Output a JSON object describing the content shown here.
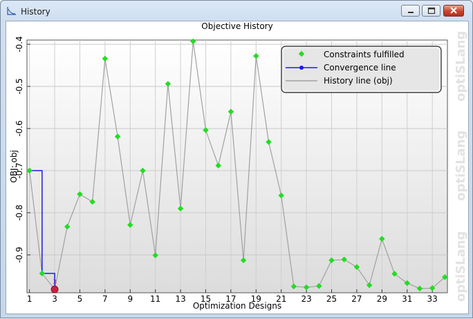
{
  "window": {
    "title": "History"
  },
  "plot": {
    "title": "Objective History",
    "watermark": "optiSLang"
  },
  "legend": [
    {
      "label": "Constraints fulfilled",
      "kind": "marker",
      "color": "#22dd22"
    },
    {
      "label": "Convergence line",
      "kind": "line-marker",
      "color": "#1a1aee"
    },
    {
      "label": "History line (obj)",
      "kind": "line",
      "color": "#a0a0a0"
    }
  ],
  "colors": {
    "history": "#a0a0a0",
    "convergence": "#1a1aee",
    "fulfilled": "#22dd22",
    "best": "#cc2244"
  },
  "chart_data": {
    "type": "line",
    "title": "Objective History",
    "xlabel": "Optimization Designs",
    "ylabel": "OBJ: obj",
    "xlim": [
      0.8,
      34.2
    ],
    "ylim": [
      -0.99,
      -0.39
    ],
    "xticks": [
      1,
      3,
      5,
      7,
      9,
      11,
      13,
      15,
      17,
      19,
      21,
      23,
      25,
      27,
      29,
      31,
      33
    ],
    "yticks": [
      -0.4,
      -0.5,
      -0.6,
      -0.7,
      -0.8,
      -0.9
    ],
    "ytick_labels": [
      "-0.4",
      "-0.5",
      "-0.6",
      "-0.7",
      "-0.8",
      "-0.9"
    ],
    "grid": true,
    "legend_position": "top-right",
    "series": [
      {
        "name": "History line (obj)",
        "x": [
          1,
          2,
          3,
          4,
          5,
          6,
          7,
          8,
          9,
          10,
          11,
          12,
          13,
          14,
          15,
          16,
          17,
          18,
          19,
          20,
          21,
          22,
          23,
          24,
          25,
          26,
          27,
          28,
          29,
          30,
          31,
          32,
          33,
          34
        ],
        "y": [
          -0.7,
          -0.944,
          -0.982,
          -0.833,
          -0.756,
          -0.774,
          -0.434,
          -0.619,
          -0.829,
          -0.7,
          -0.901,
          -0.494,
          -0.79,
          -0.393,
          -0.604,
          -0.688,
          -0.56,
          -0.913,
          -0.428,
          -0.632,
          -0.759,
          -0.975,
          -0.977,
          -0.974,
          -0.913,
          -0.911,
          -0.929,
          -0.972,
          -0.862,
          -0.945,
          -0.967,
          -0.98,
          -0.979,
          -0.953
        ]
      },
      {
        "name": "Convergence line",
        "x": [
          1,
          2,
          2,
          3,
          3
        ],
        "y": [
          -0.7,
          -0.7,
          -0.944,
          -0.944,
          -0.982
        ]
      }
    ],
    "best_design": {
      "x": 3,
      "y": -0.982,
      "label": "3"
    }
  }
}
